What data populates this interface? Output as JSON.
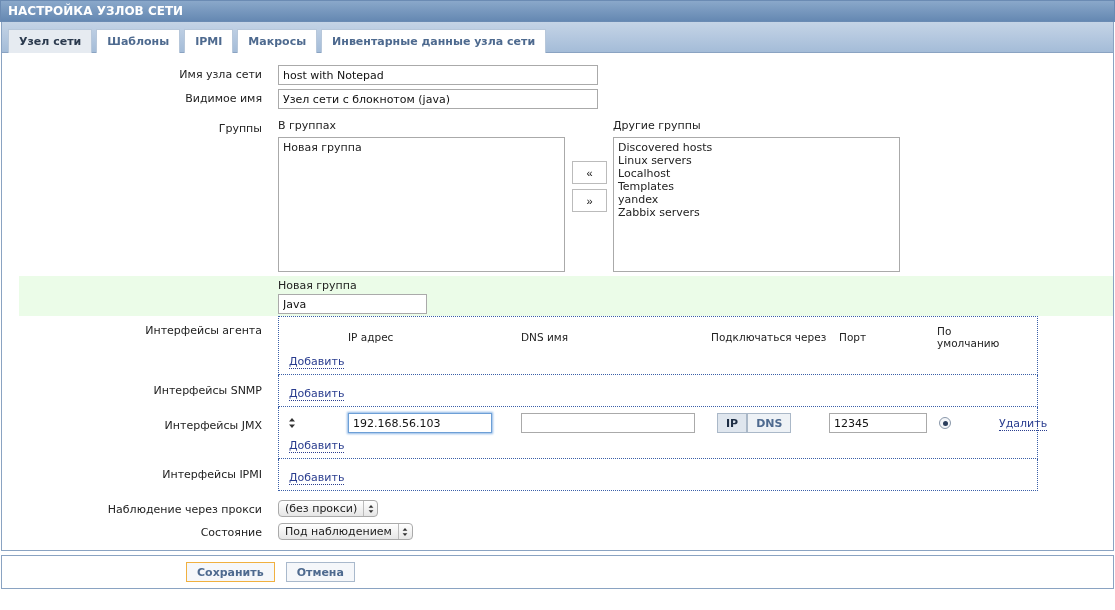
{
  "title": "НАСТРОЙКА УЗЛОВ СЕТИ",
  "tabs": [
    {
      "label": "Узел сети",
      "selected": true
    },
    {
      "label": "Шаблоны",
      "selected": false
    },
    {
      "label": "IPMI",
      "selected": false
    },
    {
      "label": "Макросы",
      "selected": false
    },
    {
      "label": "Инвентарные данные узла сети",
      "selected": false
    }
  ],
  "host_name": {
    "label": "Имя узла сети",
    "value": "host with Notepad"
  },
  "visible_name": {
    "label": "Видимое имя",
    "value": "Узел сети с блокнотом (java)"
  },
  "groups": {
    "label": "Группы",
    "in_label": "В группах",
    "in_groups": [
      "Новая группа"
    ],
    "other_label": "Другие группы",
    "other_groups": [
      "Discovered hosts",
      "Linux servers",
      "Localhost",
      "Templates",
      "yandex",
      "Zabbix servers"
    ],
    "move_left": "«",
    "move_right": "»"
  },
  "new_group": {
    "label": "Новая группа",
    "value": "Java"
  },
  "interfaces": [
    {
      "label": "Интерфейсы агента",
      "columns": [
        "IP адрес",
        "DNS имя",
        "Подключаться через",
        "Порт",
        "По умолчанию"
      ],
      "add": "Добавить"
    },
    {
      "label": "Интерфейсы SNMP",
      "add": "Добавить"
    },
    {
      "label": "Интерфейсы JMX",
      "rows": [
        {
          "ip": "192.168.56.103",
          "dns": "",
          "connect": [
            {
              "label": "IP",
              "selected": true
            },
            {
              "label": "DNS",
              "selected": false
            }
          ],
          "port": "12345",
          "default": true,
          "remove": "Удалить"
        }
      ],
      "add": "Добавить"
    },
    {
      "label": "Интерфейсы IPMI",
      "add": "Добавить"
    }
  ],
  "proxy": {
    "label": "Наблюдение через прокси",
    "value": "(без прокси)"
  },
  "status": {
    "label": "Состояние",
    "value": "Под наблюдением"
  },
  "buttons": [
    {
      "label": "Сохранить",
      "primary": true
    },
    {
      "label": "Отмена",
      "primary": false
    }
  ]
}
